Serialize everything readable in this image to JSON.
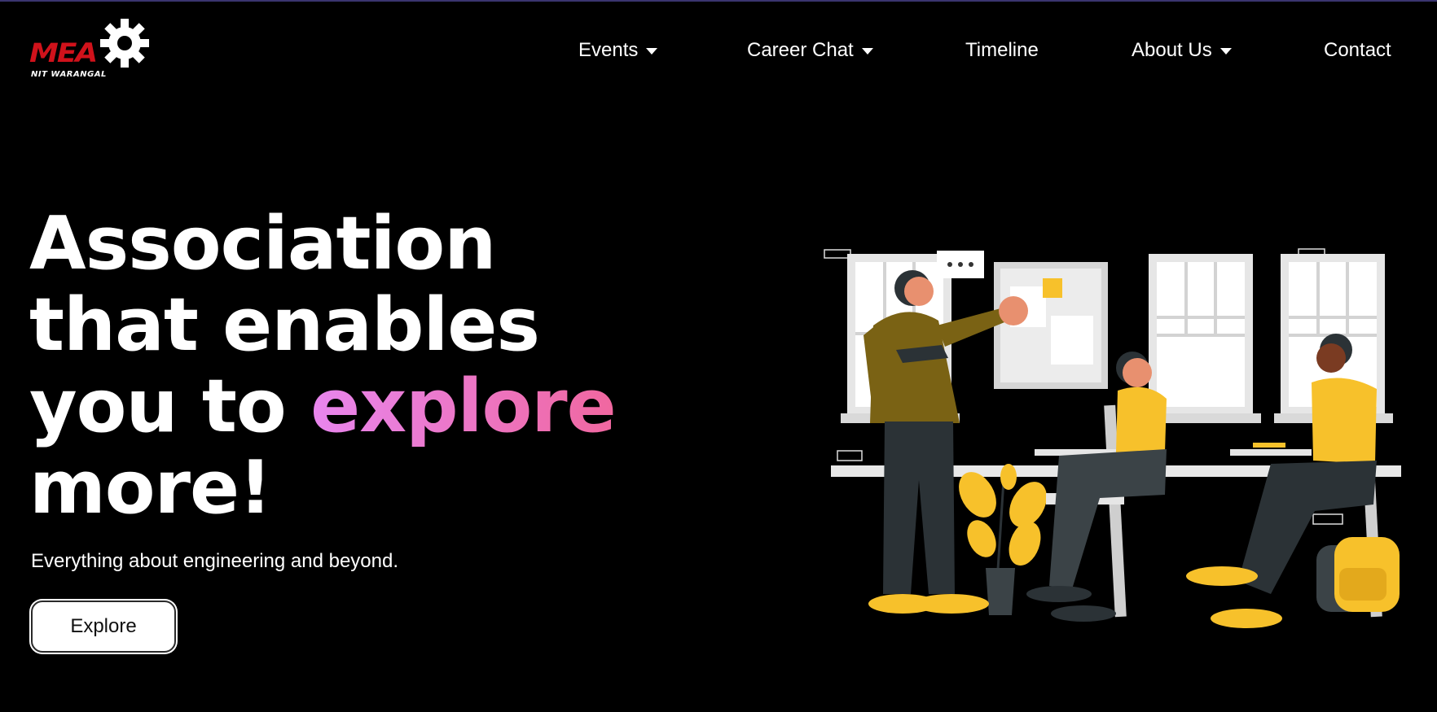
{
  "brand": {
    "logo_text": "MEA",
    "logo_subtext": "NIT WARANGAL"
  },
  "nav": {
    "items": [
      {
        "label": "Events",
        "has_dropdown": true
      },
      {
        "label": "Career Chat",
        "has_dropdown": true
      },
      {
        "label": "Timeline",
        "has_dropdown": false
      },
      {
        "label": "About Us",
        "has_dropdown": true
      },
      {
        "label": "Contact",
        "has_dropdown": false
      }
    ]
  },
  "hero": {
    "headline_line1": "Association",
    "headline_line2": "that enables",
    "headline_line3_prefix": "you to ",
    "headline_highlight": "explore",
    "headline_line4": "more!",
    "subtitle": "Everything about engineering and beyond.",
    "cta_label": "Explore"
  },
  "colors": {
    "background": "#000000",
    "logo_red": "#d0121b",
    "highlight_gradient_start": "#e886ee",
    "highlight_gradient_end": "#f0679f",
    "illustration_yellow": "#f7c12b"
  }
}
